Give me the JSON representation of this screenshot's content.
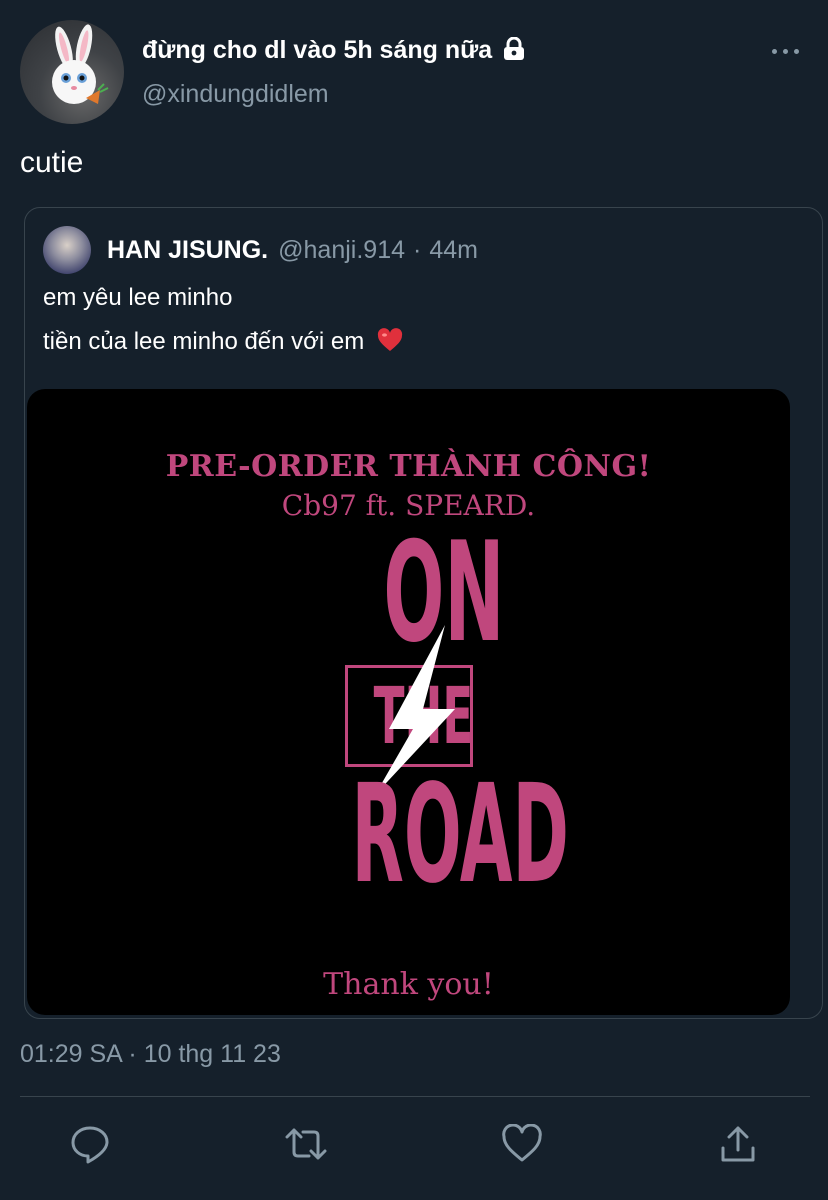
{
  "tweet": {
    "author": {
      "display_name": "đừng cho dl vào 5h sáng nữa",
      "handle": "@xindungdidlem",
      "lock_icon": "lock-icon"
    },
    "text": "cutie",
    "timestamp": "01:29 SA · 10 thg 11 23"
  },
  "quoted": {
    "display_name": "HAN JISUNG.",
    "handle": "@hanji.914",
    "separator": "·",
    "time": "44m",
    "lines": [
      "em yêu lee minho",
      "tiền của lee minho đến với em"
    ],
    "emoji": "red-heart-icon",
    "image": {
      "line1": "PRE-ORDER THÀNH CÔNG!",
      "line2": "Cb97 ft. SPEARD.",
      "logo_on": "ON",
      "logo_the": "THE",
      "logo_road": "ROAD",
      "thanks": "Thank you!"
    }
  },
  "actions": [
    "reply-icon",
    "retweet-icon",
    "like-icon",
    "share-icon"
  ],
  "colors": {
    "background": "#15202b",
    "secondary_text": "#8899a6",
    "border": "#38444d",
    "image_accent": "#c0477d"
  }
}
